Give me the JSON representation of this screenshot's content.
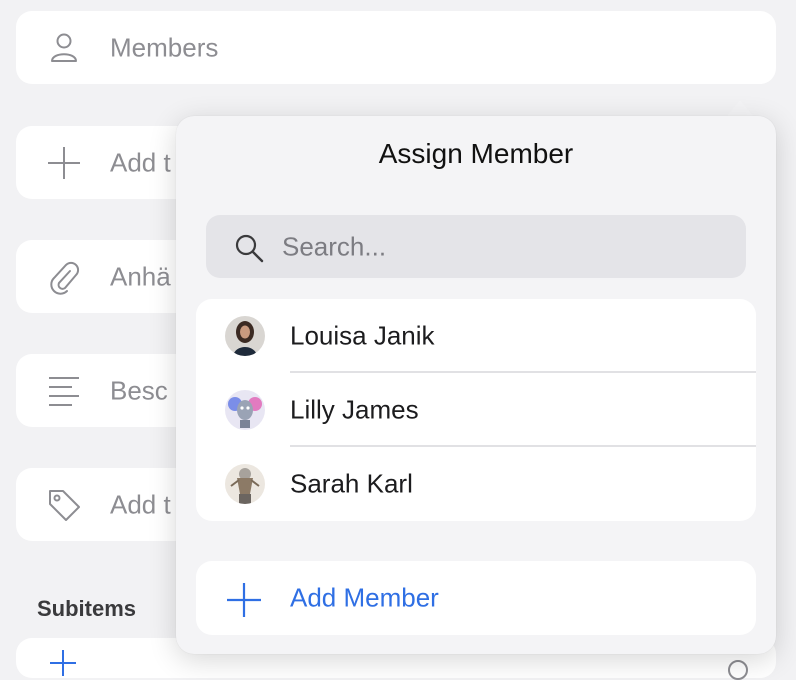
{
  "background_rows": [
    {
      "label": "Members",
      "icon": "person-icon"
    },
    {
      "label": "Add t",
      "icon": "plus-icon"
    },
    {
      "label": "Anhä",
      "icon": "paperclip-icon"
    },
    {
      "label": "Besc",
      "icon": "lines-icon"
    },
    {
      "label": "Add t",
      "icon": "tag-icon"
    }
  ],
  "section": {
    "title": "Subitems"
  },
  "popover": {
    "title": "Assign Member",
    "search": {
      "placeholder": "Search..."
    },
    "members": [
      {
        "name": "Louisa Janik"
      },
      {
        "name": "Lilly James"
      },
      {
        "name": "Sarah Karl"
      }
    ],
    "add_label": "Add Member"
  },
  "colors": {
    "accent": "#2f6fe4",
    "placeholder": "#8d8d92"
  }
}
